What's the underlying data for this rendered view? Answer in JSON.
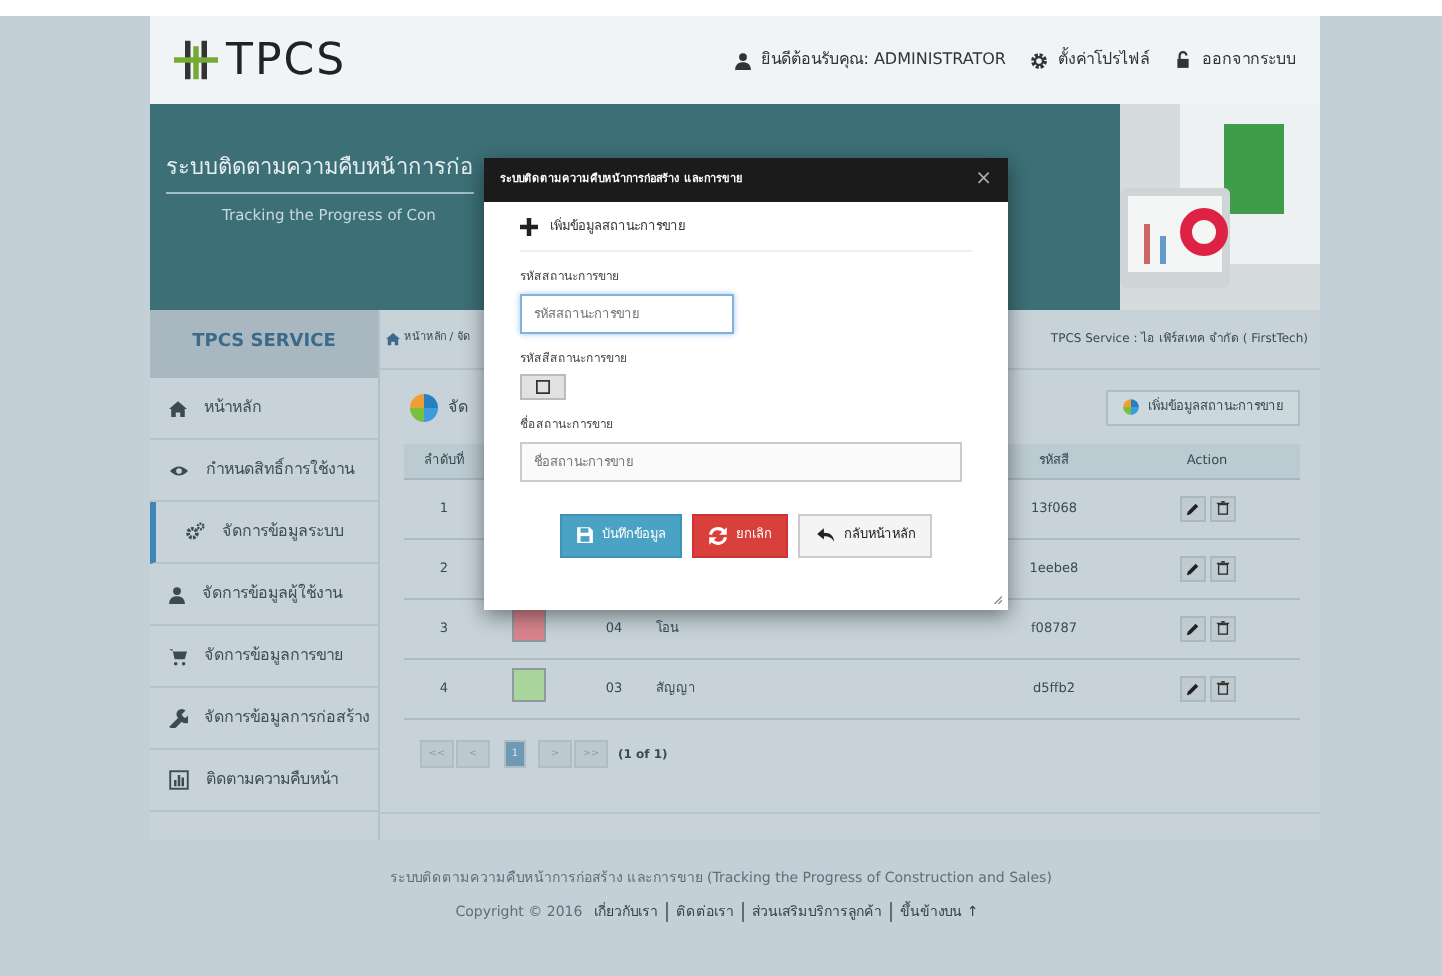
{
  "header": {
    "logo": "TPCS",
    "welcome": "ยินดีต้อนรับคุณ:  ADMINISTRATOR",
    "profile": "ตั้งค่าโปรไฟล์",
    "logout": "ออกจากระบบ"
  },
  "banner": {
    "title": "ระบบติดตามความคืบหน้าการก่อ",
    "subtitle": "Tracking the Progress of Con"
  },
  "sidebar": {
    "title": "TPCS SERVICE",
    "items": [
      {
        "label": "หน้าหลัก",
        "selected": false
      },
      {
        "label": "กำหนดสิทธิ์การใช้งาน",
        "selected": false
      },
      {
        "label": "จัดการข้อมูลระบบ",
        "selected": true
      },
      {
        "label": "จัดการข้อมูลผู้ใช้งาน",
        "selected": false
      },
      {
        "label": "จัดการข้อมูลการขาย",
        "selected": false
      },
      {
        "label": "จัดการข้อมูลการก่อสร้าง",
        "selected": false
      },
      {
        "label": "ติดตามความคืบหน้า",
        "selected": false
      }
    ]
  },
  "breadcrumb": {
    "path": "หน้าหลัก / จัด",
    "company": "TPCS Service : ไอ เฟิร์สเทค จำกัด ( FirstTech)"
  },
  "panel": {
    "title": "จัด",
    "add_button": "เพิ่มข้อมูลสถานะการขาย"
  },
  "table": {
    "columns": [
      "ลำดับที่",
      "รหัสสี",
      "Action"
    ],
    "rows": [
      {
        "no": "1",
        "color": null,
        "code": "",
        "name": "",
        "hex": "13f068"
      },
      {
        "no": "2",
        "color": null,
        "code": "",
        "name": "",
        "hex": "1eebe8"
      },
      {
        "no": "3",
        "color": "#d9848d",
        "code": "04",
        "name": "โอน",
        "hex": "f08787"
      },
      {
        "no": "4",
        "color": "#a9d59c",
        "code": "03",
        "name": "สัญญา",
        "hex": "d5ffb2"
      }
    ]
  },
  "pagination": {
    "pages": [
      {
        "label": "<<",
        "selected": false
      },
      {
        "label": "<",
        "selected": false
      },
      {
        "label": "1",
        "selected": true
      },
      {
        "label": ">",
        "selected": false
      },
      {
        "label": ">>",
        "selected": false
      }
    ],
    "summary": "(1 of 1)"
  },
  "modal": {
    "title": "ระบบติดตามความคืบหน้าการก่อสร้าง และการขาย",
    "close": "×",
    "heading": "เพิ่มข้อมูลสถานะการขาย",
    "fields": [
      {
        "kind": "text",
        "label": "รหัสสถานะการขาย",
        "placeholder": "รหัสสถานะการขาย"
      },
      {
        "kind": "color",
        "label": "รหัสสีสถานะการขาย"
      },
      {
        "kind": "wide",
        "label": "ชื่อสถานะการขาย",
        "placeholder": "ชื่อสถานะการขาย"
      }
    ],
    "buttons": [
      {
        "kind": "save",
        "label": "บันทึกข้อมูล"
      },
      {
        "kind": "cancel",
        "label": "ยกเลิก"
      },
      {
        "kind": "back",
        "label": "กลับหน้าหลัก"
      }
    ]
  },
  "footer": {
    "line": "ระบบติดตามความคืบหน้าการก่อสร้าง และการขาย  (Tracking the Progress of Construction and Sales)",
    "copyright": "Copyright © 2016",
    "links": [
      "เกี่ยวกับเรา",
      "ติดต่อเรา",
      "ส่วนเสริมบริการลูกค้า",
      "ขึ้นข้างบน ↑"
    ]
  }
}
